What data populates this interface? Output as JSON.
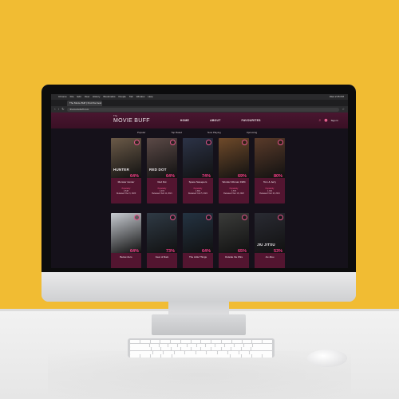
{
  "mac_menubar": {
    "app": "Chrome",
    "items": [
      "File",
      "Edit",
      "View",
      "History",
      "Bookmarks",
      "People",
      "Tab",
      "Window",
      "Help"
    ],
    "clock": "Wed 2:45 PM"
  },
  "browser": {
    "tab_title": "The Movie Buff | Find the best movies",
    "url": "themoviebuff.com"
  },
  "site": {
    "logo_prefix": "The",
    "logo": "MOVIE BUFF",
    "nav": [
      "HOME",
      "ABOUT",
      "FAVOURITES"
    ],
    "sign_in": "Sign In",
    "subnav": [
      "Popular",
      "Top Rated",
      "Now Playing",
      "Upcoming"
    ]
  },
  "movies": [
    {
      "title": "Monster Hunter",
      "poster_text": "HUNTER",
      "rating": "64%",
      "meta_label": "Popularity",
      "meta_value": "2,548",
      "meta_date": "Released: Dec 3, 2020",
      "poster_color": "#6b5a48"
    },
    {
      "title": "Red Dot",
      "poster_text": "RED DOT",
      "rating": "64%",
      "meta_label": "Popularity",
      "meta_value": "1,974",
      "meta_date": "Released: Feb 11, 2021",
      "poster_color": "#5c4a47"
    },
    {
      "title": "Space Sweepers",
      "poster_text": "",
      "rating": "74%",
      "meta_label": "Popularity",
      "meta_value": "1,864",
      "meta_date": "Released: Feb 5, 2021",
      "poster_color": "#2c3347"
    },
    {
      "title": "Wonder Woman 1984",
      "poster_text": "",
      "rating": "69%",
      "meta_label": "Popularity",
      "meta_value": "1,570",
      "meta_date": "Released: Dec 16, 2020",
      "poster_color": "#6f4a2a"
    },
    {
      "title": "Tom & Jerry",
      "poster_text": "",
      "rating": "80%",
      "meta_label": "Popularity",
      "meta_value": "1,364",
      "meta_date": "Released: Feb 10, 2021",
      "poster_color": "#5a3b2a"
    },
    {
      "title": "Below Zero",
      "poster_text": "",
      "rating": "64%",
      "meta_label": "",
      "meta_value": "",
      "meta_date": "",
      "poster_color": "#c8ccd2"
    },
    {
      "title": "Fear of Rain",
      "poster_text": "",
      "rating": "73%",
      "meta_label": "",
      "meta_value": "",
      "meta_date": "",
      "poster_color": "#2f3a45"
    },
    {
      "title": "The Little Things",
      "poster_text": "",
      "rating": "64%",
      "meta_label": "",
      "meta_value": "",
      "meta_date": "",
      "poster_color": "#243342"
    },
    {
      "title": "Outside the Wire",
      "poster_text": "",
      "rating": "65%",
      "meta_label": "",
      "meta_value": "",
      "meta_date": "",
      "poster_color": "#3b3c3a"
    },
    {
      "title": "Jiu Jitsu",
      "poster_text": "JIU JITSU",
      "rating": "53%",
      "meta_label": "",
      "meta_value": "",
      "meta_date": "",
      "poster_color": "#2a2b33"
    }
  ],
  "colors": {
    "wall": "#f1bc33",
    "screen_bg": "#15111a",
    "header": "#4a1630",
    "card": "#531530",
    "accent": "#ff3d8b"
  }
}
